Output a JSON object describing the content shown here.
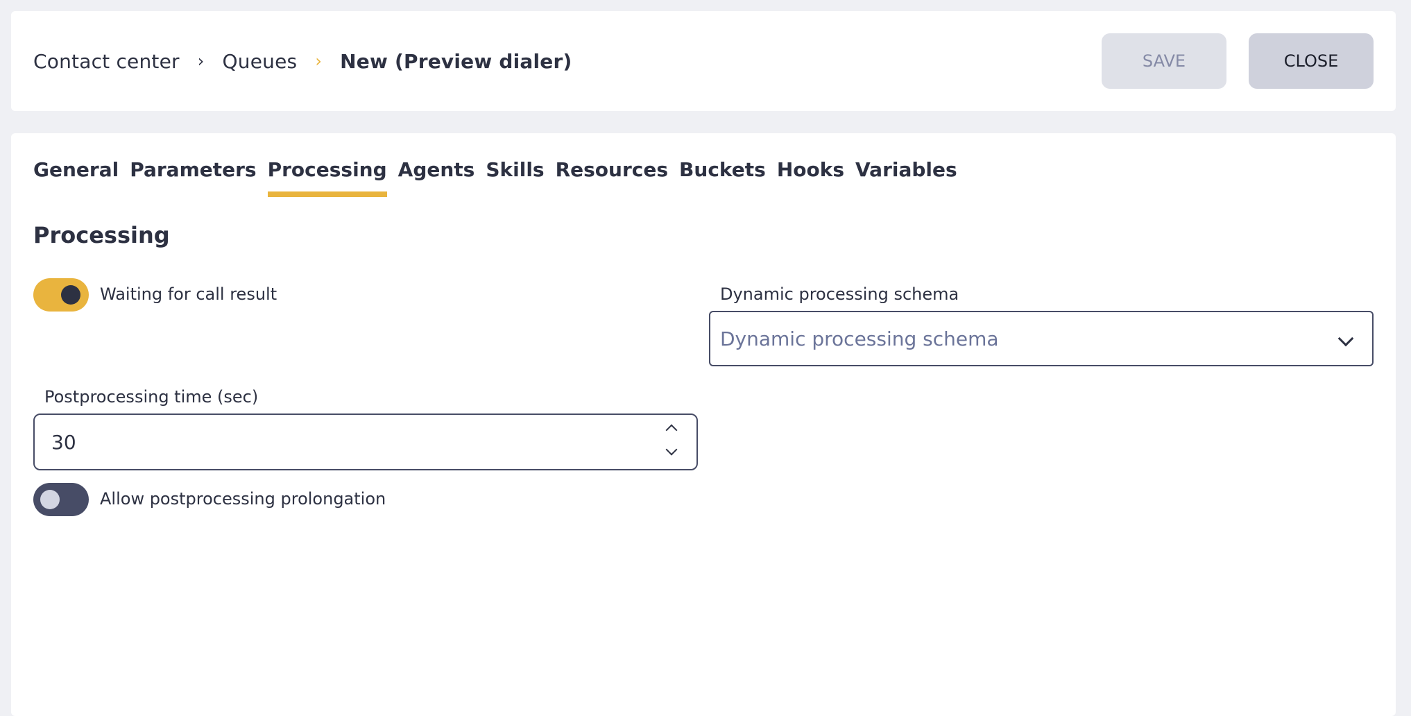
{
  "header": {
    "breadcrumb": [
      "Contact center",
      "Queues",
      "New (Preview dialer)"
    ],
    "save_label": "SAVE",
    "close_label": "CLOSE"
  },
  "tabs": [
    {
      "label": "General",
      "active": false
    },
    {
      "label": "Parameters",
      "active": false
    },
    {
      "label": "Processing",
      "active": true
    },
    {
      "label": "Agents",
      "active": false
    },
    {
      "label": "Skills",
      "active": false
    },
    {
      "label": "Resources",
      "active": false
    },
    {
      "label": "Buckets",
      "active": false
    },
    {
      "label": "Hooks",
      "active": false
    },
    {
      "label": "Variables",
      "active": false
    }
  ],
  "processing": {
    "title": "Processing",
    "waiting_for_call_result": {
      "label": "Waiting for call result",
      "on": true
    },
    "dynamic_schema": {
      "label": "Dynamic processing schema",
      "placeholder": "Dynamic processing schema"
    },
    "postprocessing_time": {
      "label": "Postprocessing time (sec)",
      "value": "30"
    },
    "allow_prolongation": {
      "label": "Allow postprocessing prolongation",
      "on": false
    }
  },
  "colors": {
    "accent": "#e9b43e",
    "text": "#2d3142",
    "background": "#eff0f4"
  }
}
